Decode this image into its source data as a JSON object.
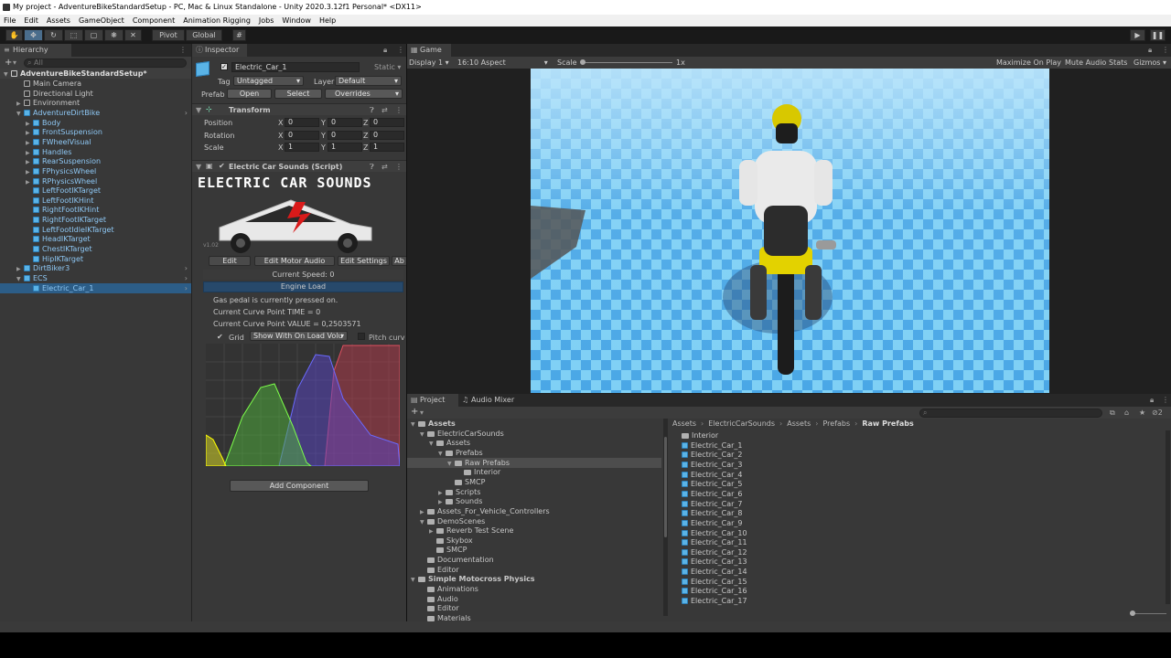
{
  "window": {
    "title": "My project - AdventureBikeStandardSetup - PC, Mac & Linux Standalone - Unity 2020.3.12f1 Personal* <DX11>"
  },
  "menu": [
    "File",
    "Edit",
    "Assets",
    "GameObject",
    "Component",
    "Animation Rigging",
    "Jobs",
    "Window",
    "Help"
  ],
  "toolbar": {
    "pivot": "Pivot",
    "global": "Global"
  },
  "hierarchy": {
    "tab": "Hierarchy",
    "search_placeholder": "All",
    "scene": "AdventureBikeStandardSetup*",
    "items": [
      {
        "label": "Main Camera",
        "depth": 1,
        "arrow": "",
        "blue": false
      },
      {
        "label": "Directional Light",
        "depth": 1,
        "arrow": "",
        "blue": false
      },
      {
        "label": "Environment",
        "depth": 1,
        "arrow": "▶",
        "blue": false
      },
      {
        "label": "AdventureDirtBike",
        "depth": 1,
        "arrow": "▼",
        "blue": true
      },
      {
        "label": "Body",
        "depth": 2,
        "arrow": "▶",
        "blue": true
      },
      {
        "label": "FrontSuspension",
        "depth": 2,
        "arrow": "▶",
        "blue": true
      },
      {
        "label": "FWheelVisual",
        "depth": 2,
        "arrow": "▶",
        "blue": true
      },
      {
        "label": "Handles",
        "depth": 2,
        "arrow": "▶",
        "blue": true
      },
      {
        "label": "RearSuspension",
        "depth": 2,
        "arrow": "▶",
        "blue": true
      },
      {
        "label": "FPhysicsWheel",
        "depth": 2,
        "arrow": "▶",
        "blue": true
      },
      {
        "label": "RPhysicsWheel",
        "depth": 2,
        "arrow": "▶",
        "blue": true
      },
      {
        "label": "LeftFootIKTarget",
        "depth": 2,
        "arrow": "",
        "blue": true
      },
      {
        "label": "LeftFootIKHint",
        "depth": 2,
        "arrow": "",
        "blue": true
      },
      {
        "label": "RightFootIKHint",
        "depth": 2,
        "arrow": "",
        "blue": true
      },
      {
        "label": "RightFootIKTarget",
        "depth": 2,
        "arrow": "",
        "blue": true
      },
      {
        "label": "LeftFootIdleIKTarget",
        "depth": 2,
        "arrow": "",
        "blue": true
      },
      {
        "label": "HeadIKTarget",
        "depth": 2,
        "arrow": "",
        "blue": true
      },
      {
        "label": "ChestIKTarget",
        "depth": 2,
        "arrow": "",
        "blue": true
      },
      {
        "label": "HipIKTarget",
        "depth": 2,
        "arrow": "",
        "blue": true
      },
      {
        "label": "DirtBiker3",
        "depth": 1,
        "arrow": "▶",
        "blue": true
      },
      {
        "label": "ECS",
        "depth": 1,
        "arrow": "▼",
        "blue": true
      },
      {
        "label": "Electric_Car_1",
        "depth": 2,
        "arrow": "",
        "blue": true
      }
    ]
  },
  "inspector": {
    "tab": "Inspector",
    "object_name": "Electric_Car_1",
    "static": "Static",
    "tag_label": "Tag",
    "tag_value": "Untagged",
    "layer_label": "Layer",
    "layer_value": "Default",
    "prefab_label": "Prefab",
    "open": "Open",
    "select": "Select",
    "overrides": "Overrides",
    "transform": {
      "title": "Transform",
      "rows": [
        {
          "label": "Position",
          "x": "0",
          "y": "0",
          "z": "0"
        },
        {
          "label": "Rotation",
          "x": "0",
          "y": "0",
          "z": "0"
        },
        {
          "label": "Scale",
          "x": "1",
          "y": "1",
          "z": "1"
        }
      ]
    },
    "script": {
      "title": "Electric Car Sounds (Script)",
      "banner": "ELECTRIC CAR SOUNDS",
      "version": "v1.02",
      "buttons": [
        "Edit Curves",
        "Edit Motor Audio Clips",
        "Edit Settings",
        "Ab"
      ],
      "current_speed": "Current Speed: 0",
      "engine_load": "Engine Load",
      "gas_pedal": "Gas pedal is currently pressed on.",
      "curve_time": "Current Curve Point TIME = 0",
      "curve_value": "Current Curve Point VALUE = 0,2503571",
      "grid": "Grid",
      "show_mode": "Show With On Load Volu",
      "pitch": "Pitch curv"
    },
    "add_component": "Add Component"
  },
  "game": {
    "tab": "Game",
    "display": "Display 1",
    "aspect": "16:10 Aspect",
    "scale_label": "Scale",
    "scale_value": "1x",
    "options": [
      "Maximize On Play",
      "Mute Audio",
      "Stats",
      "Gizmos"
    ]
  },
  "project": {
    "tabs": [
      "Project",
      "Audio Mixer"
    ],
    "breadcrumb": [
      "Assets",
      "ElectricCarSounds",
      "Assets",
      "Prefabs",
      "Raw Prefabs"
    ],
    "tree": [
      {
        "label": "Assets",
        "depth": 0,
        "arrow": "▼"
      },
      {
        "label": "ElectricCarSounds",
        "depth": 1,
        "arrow": "▼"
      },
      {
        "label": "Assets",
        "depth": 2,
        "arrow": "▼"
      },
      {
        "label": "Prefabs",
        "depth": 3,
        "arrow": "▼"
      },
      {
        "label": "Raw Prefabs",
        "depth": 4,
        "arrow": "▼"
      },
      {
        "label": "Interior",
        "depth": 5,
        "arrow": ""
      },
      {
        "label": "SMCP",
        "depth": 4,
        "arrow": ""
      },
      {
        "label": "Scripts",
        "depth": 3,
        "arrow": "▶"
      },
      {
        "label": "Sounds",
        "depth": 3,
        "arrow": "▶"
      },
      {
        "label": "Assets_For_Vehicle_Controllers",
        "depth": 1,
        "arrow": "▶"
      },
      {
        "label": "DemoScenes",
        "depth": 1,
        "arrow": "▼"
      },
      {
        "label": "Reverb Test Scene",
        "depth": 2,
        "arrow": "▶"
      },
      {
        "label": "Skybox",
        "depth": 2,
        "arrow": ""
      },
      {
        "label": "SMCP",
        "depth": 2,
        "arrow": ""
      },
      {
        "label": "Documentation",
        "depth": 1,
        "arrow": ""
      },
      {
        "label": "Editor",
        "depth": 1,
        "arrow": ""
      },
      {
        "label": "Simple Motocross Physics",
        "depth": 0,
        "arrow": "▼"
      },
      {
        "label": "Animations",
        "depth": 1,
        "arrow": ""
      },
      {
        "label": "Audio",
        "depth": 1,
        "arrow": ""
      },
      {
        "label": "Editor",
        "depth": 1,
        "arrow": ""
      },
      {
        "label": "Materials",
        "depth": 1,
        "arrow": ""
      }
    ],
    "files": [
      {
        "label": "Interior",
        "folder": true
      },
      {
        "label": "Electric_Car_1",
        "folder": false
      },
      {
        "label": "Electric_Car_2",
        "folder": false
      },
      {
        "label": "Electric_Car_3",
        "folder": false
      },
      {
        "label": "Electric_Car_4",
        "folder": false
      },
      {
        "label": "Electric_Car_5",
        "folder": false
      },
      {
        "label": "Electric_Car_6",
        "folder": false
      },
      {
        "label": "Electric_Car_7",
        "folder": false
      },
      {
        "label": "Electric_Car_8",
        "folder": false
      },
      {
        "label": "Electric_Car_9",
        "folder": false
      },
      {
        "label": "Electric_Car_10",
        "folder": false
      },
      {
        "label": "Electric_Car_11",
        "folder": false
      },
      {
        "label": "Electric_Car_12",
        "folder": false
      },
      {
        "label": "Electric_Car_13",
        "folder": false
      },
      {
        "label": "Electric_Car_14",
        "folder": false
      },
      {
        "label": "Electric_Car_15",
        "folder": false
      },
      {
        "label": "Electric_Car_16",
        "folder": false
      },
      {
        "label": "Electric_Car_17",
        "folder": false
      }
    ],
    "hidden_count": "2"
  },
  "colors": {
    "selection": "#2c5d87",
    "prefab_blue": "#7fb8e8",
    "tile_blue": "#4aa7e6"
  }
}
